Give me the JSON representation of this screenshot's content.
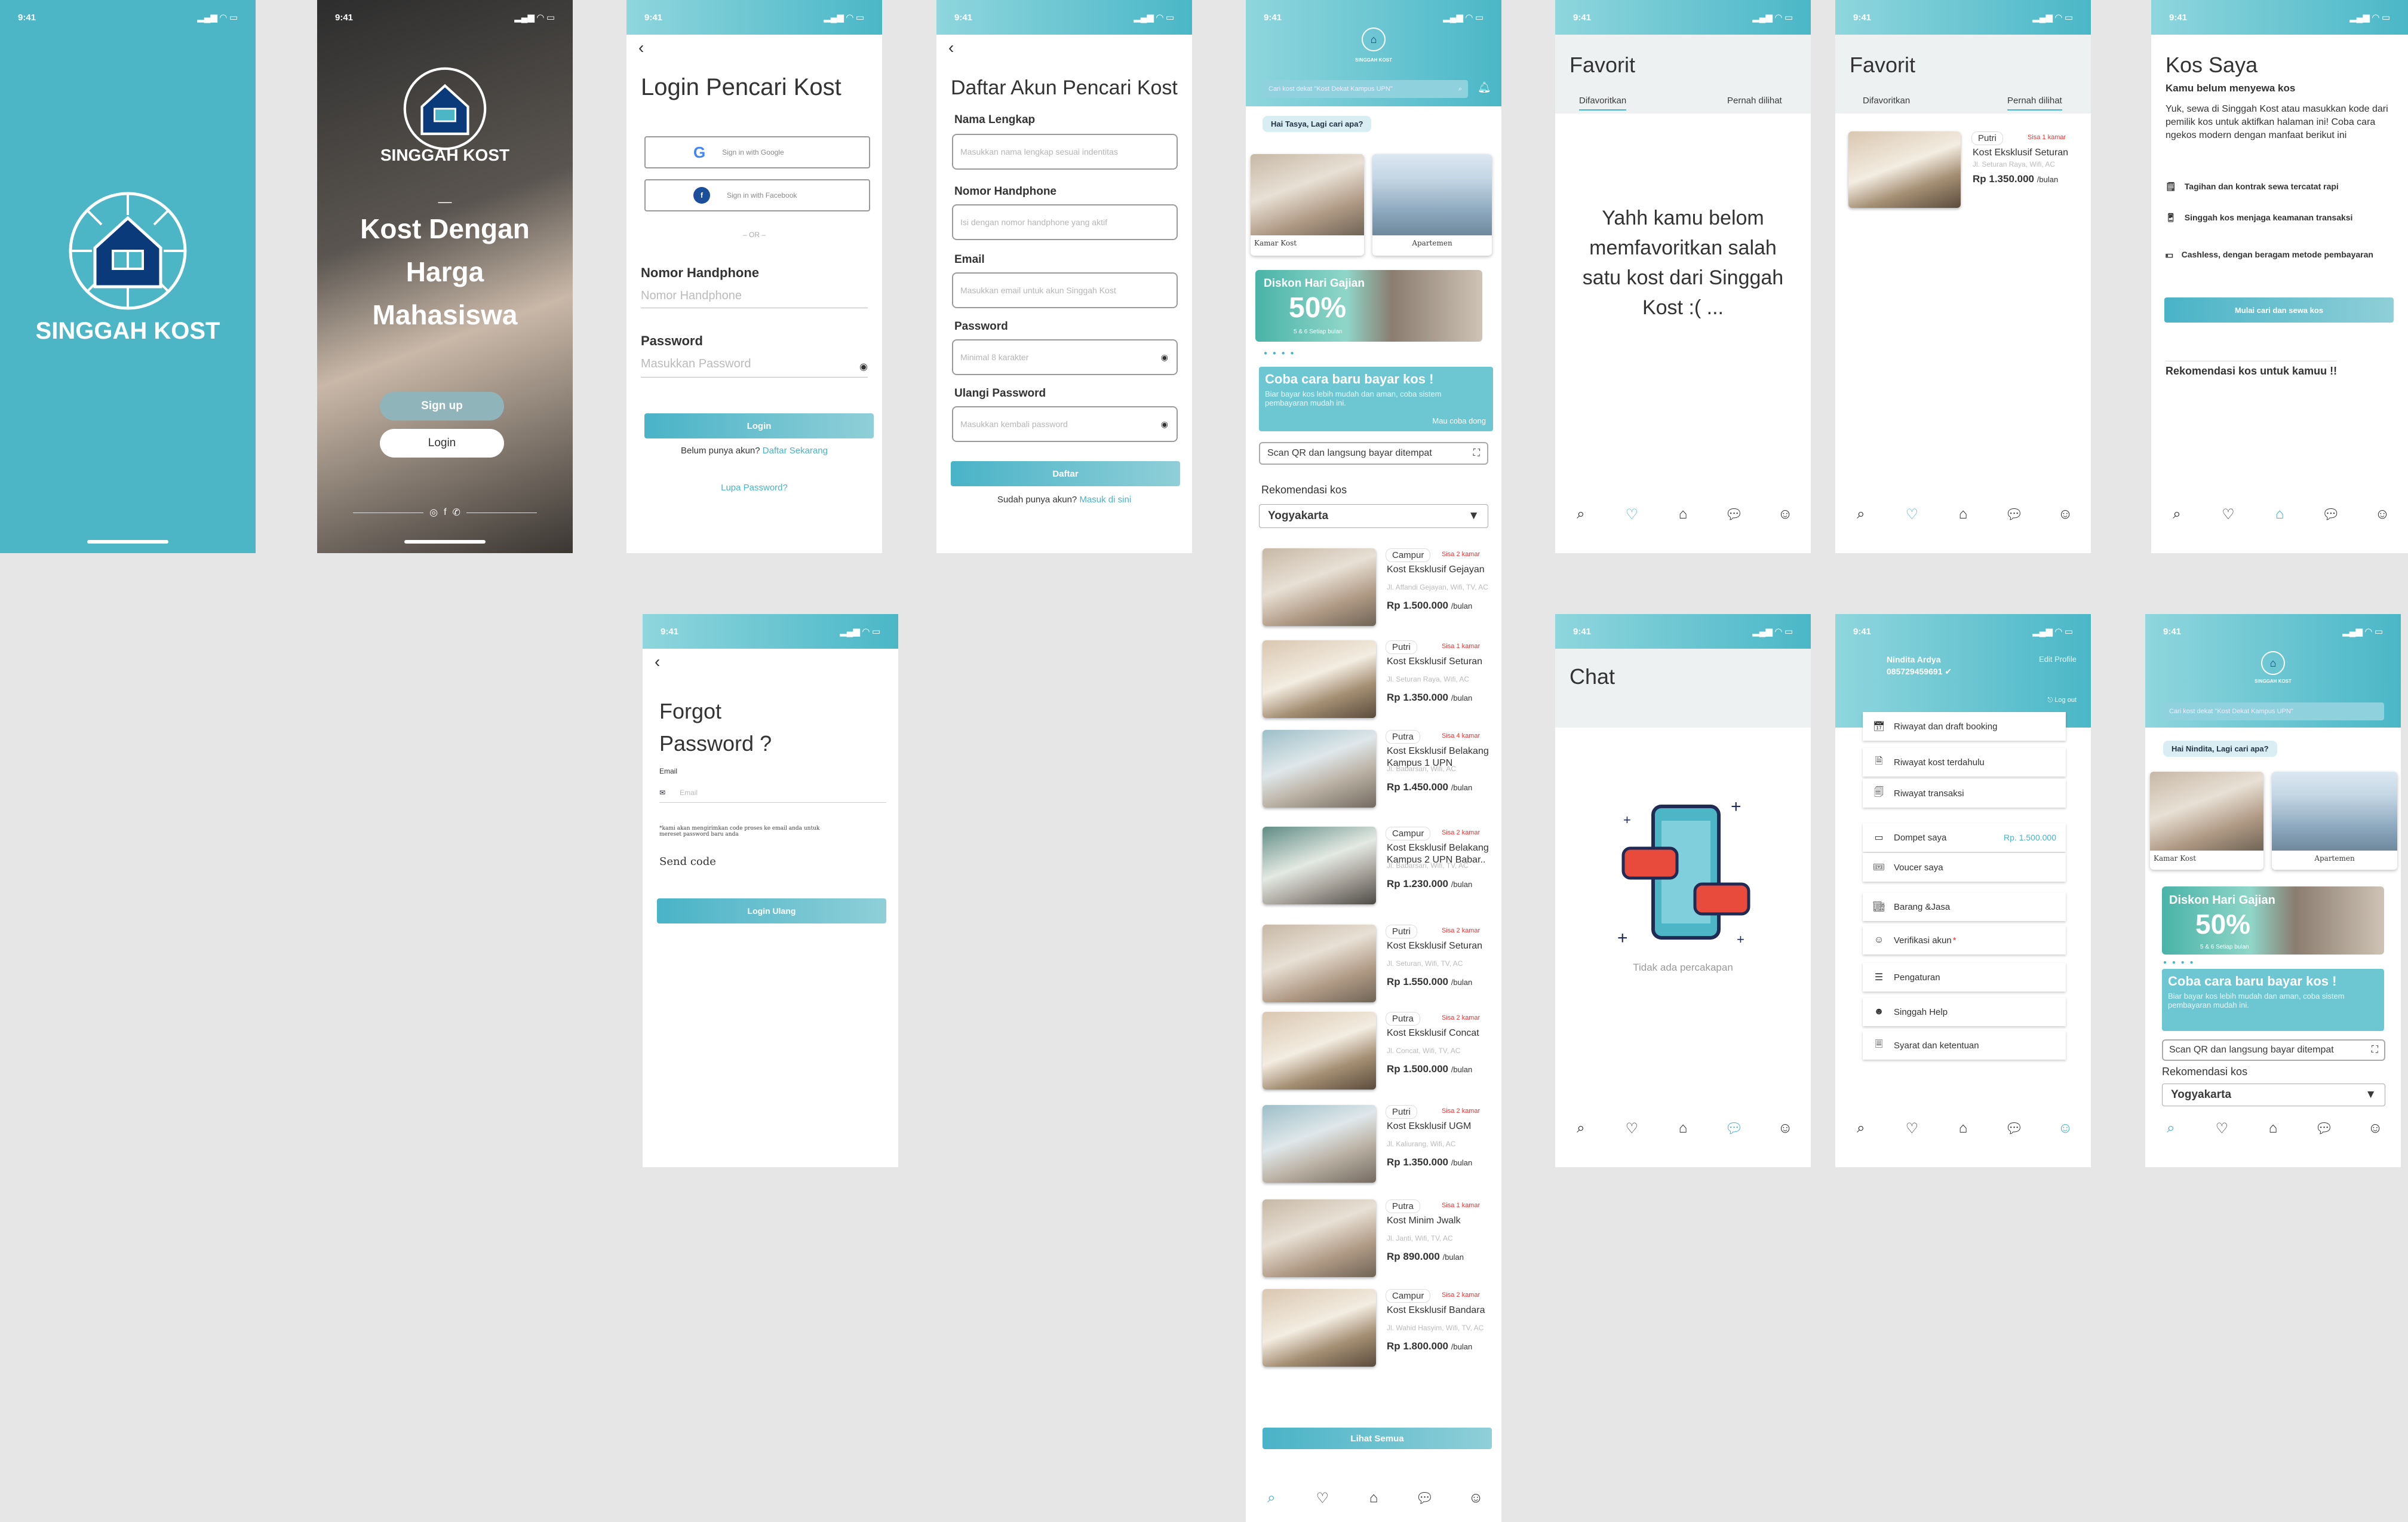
{
  "status_time": "9:41",
  "colors": {
    "teal": "#4cb6c6",
    "accent": "#49b3c7",
    "red": "#e33333",
    "navy": "#0b3a7a"
  },
  "splash": {
    "brand": "SINGGAH KOST"
  },
  "welcome": {
    "brand": "SINGGAH KOST",
    "dash": "_",
    "tagline_1": "Kost Dengan",
    "tagline_2": "Harga",
    "tagline_3": "Mahasiswa",
    "signup": "Sign up",
    "login": "Login"
  },
  "login": {
    "title": "Login Pencari Kost",
    "google": "Sign in with Google",
    "facebook": "Sign in with Facebook",
    "or": "– OR –",
    "phone_label": "Nomor Handphone",
    "phone_placeholder": "Nomor Handphone",
    "password_label": "Password",
    "password_placeholder": "Masukkan Password",
    "button": "Login",
    "no_account": "Belum punya akun?",
    "register_link": "Daftar Sekarang",
    "forgot": "Lupa Password?"
  },
  "register": {
    "title": "Daftar Akun Pencari Kost",
    "name_label": "Nama Lengkap",
    "name_placeholder": "Masukkan nama lengkap sesuai indentitas",
    "phone_label": "Nomor Handphone",
    "phone_placeholder": "Isi dengan nomor handphone yang aktif",
    "email_label": "Email",
    "email_placeholder": "Masukkan email untuk akun Singgah Kost",
    "password_label": "Password",
    "password_placeholder": "Minimal 8 karakter",
    "repeat_label": "Ulangi Password",
    "repeat_placeholder": "Masukkan kembali password",
    "button": "Daftar",
    "have_account": "Sudah punya akun?",
    "login_link": "Masuk di sini"
  },
  "forgot": {
    "title_1": "Forgot",
    "title_2": "Password ?",
    "email_label": "Email",
    "email_placeholder": "Email",
    "note": "*kami akan mengirimkan code proses ke email anda untuk mereset password baru anda",
    "send_code": "Send code",
    "button": "Login Ulang"
  },
  "home": {
    "brand": "SINGGAH KOST",
    "search_placeholder": "Cari kost dekat \"Kost Dekat Kampus UPN\"",
    "greeting": "Hai Tasya, Lagi cari apa?",
    "cat_1": "Kamar Kost",
    "cat_2": "Apartemen",
    "promo_title": "Diskon Hari Gajian",
    "promo_value": "50%",
    "promo_date": "5 & 6 Setiap bulan",
    "pay_title": "Coba cara baru bayar kos !",
    "pay_desc": "Biar bayar kos lebih mudah dan aman, coba sistem pembayaran mudah ini.",
    "pay_cta": "Mau coba dong",
    "scan": "Scan QR dan langsung bayar ditempat",
    "reco_label": "Rekomendasi kos",
    "city": "Yogyakarta",
    "see_all": "Lihat Semua",
    "listings": [
      {
        "type": "Campur",
        "stock": "Sisa 2 kamar",
        "name": "Kost Eksklusif Gejayan",
        "addr": "Jl. Affandi Gejayan, Wifi, TV, AC",
        "price": "Rp 1.500.000",
        "unit": "/bulan"
      },
      {
        "type": "Putri",
        "stock": "Sisa 1 kamar",
        "name": "Kost Eksklusif Seturan",
        "addr": "Jl. Seturan Raya, Wifi, AC",
        "price": "Rp 1.350.000",
        "unit": "/bulan"
      },
      {
        "type": "Putra",
        "stock": "Sisa 4 kamar",
        "name": "Kost Eksklusif Belakang Kampus 1 UPN",
        "addr": "Jl. Babarsari, Wifi, AC",
        "price": "Rp 1.450.000",
        "unit": "/bulan"
      },
      {
        "type": "Campur",
        "stock": "Sisa 2 kamar",
        "name": "Kost Eksklusif Belakang Kampus 2 UPN Babar..",
        "addr": "Jl. Babarsari, Wifi, TV, AC",
        "price": "Rp 1.230.000",
        "unit": "/bulan"
      },
      {
        "type": "Putri",
        "stock": "Sisa 2 kamar",
        "name": "Kost Eksklusif Seturan",
        "addr": "Jl. Seturan, Wifi, TV, AC",
        "price": "Rp 1.550.000",
        "unit": "/bulan"
      },
      {
        "type": "Putra",
        "stock": "Sisa 2 kamar",
        "name": "Kost Eksklusif Concat",
        "addr": "Jl. Concat, Wifi, TV, AC",
        "price": "Rp 1.500.000",
        "unit": "/bulan"
      },
      {
        "type": "Putri",
        "stock": "Sisa 2 kamar",
        "name": "Kost Eksklusif UGM",
        "addr": "Jl. Kaliurang, Wifi, AC",
        "price": "Rp 1.350.000",
        "unit": "/bulan"
      },
      {
        "type": "Putra",
        "stock": "Sisa 1 kamar",
        "name": "Kost Minim Jwalk",
        "addr": "Jl. Janti, Wifi, TV, AC",
        "price": "Rp 890.000",
        "unit": "/bulan"
      },
      {
        "type": "Campur",
        "stock": "Sisa 2 kamar",
        "name": "Kost Eksklusif Bandara",
        "addr": "Jl. Wahid Hasyim, Wifi, TV, AC",
        "price": "Rp 1.800.000",
        "unit": "/bulan"
      }
    ]
  },
  "fav_empty": {
    "title": "Favorit",
    "tab_1": "Difavoritkan",
    "tab_2": "Pernah dilihat",
    "message": "Yahh kamu belom memfavoritkan salah satu kost dari Singgah Kost :( ..."
  },
  "fav_list": {
    "title": "Favorit",
    "tab_1": "Difavoritkan",
    "tab_2": "Pernah dilihat",
    "type": "Putri",
    "stock": "Sisa 1 kamar",
    "name": "Kost Eksklusif Seturan",
    "addr": "Jl. Seturan Raya, Wifi, AC",
    "price": "Rp 1.350.000",
    "unit": "/bulan"
  },
  "mykos": {
    "title": "Kos Saya",
    "subtitle": "Kamu belum menyewa kos",
    "desc": "Yuk, sewa di Singgah Kost atau masukkan kode dari pemilik kos untuk aktifkan halaman ini! Coba cara ngekos modern dengan manfaat berikut ini",
    "benefit_1": "Tagihan dan kontrak sewa tercatat rapi",
    "benefit_2": "Singgah kos menjaga keamanan transaksi",
    "benefit_3": "Cashless, dengan beragam metode pembayaran",
    "button": "Mulai cari dan sewa kos",
    "reco": "Rekomendasi kos untuk kamuu !!"
  },
  "chat": {
    "title": "Chat",
    "empty": "Tidak ada percakapan"
  },
  "profile": {
    "name": "Nindita Ardya",
    "phone": "085729459691",
    "edit": "Edit Profile",
    "logout": "Log out",
    "menu": [
      "Riwayat dan draft booking",
      "Riwayat kost terdahulu",
      "Riwayat transaksi",
      "Dompet saya",
      "Voucer saya",
      "Barang &Jasa",
      "Verifikasi akun",
      "Pengaturan",
      "Singgah Help",
      "Syarat dan ketentuan"
    ],
    "wallet": "Rp. 1.500.000"
  },
  "home2": {
    "brand": "SINGGAH KOST",
    "search_placeholder": "Cari kost dekat \"Kost Dekat Kampus UPN\"",
    "greeting": "Hai Nindita, Lagi cari apa?",
    "cat_1": "Kamar Kost",
    "cat_2": "Apartemen",
    "promo_title": "Diskon Hari Gajian",
    "promo_value": "50%",
    "promo_date": "5 & 6 Setiap bulan",
    "pay_title": "Coba cara baru bayar kos !",
    "pay_desc": "Biar bayar kos lebih mudah dan aman, coba sistem pembayaran mudah ini.",
    "scan": "Scan QR dan langsung bayar ditempat",
    "reco_label": "Rekomendasi kos",
    "city": "Yogyakarta"
  }
}
